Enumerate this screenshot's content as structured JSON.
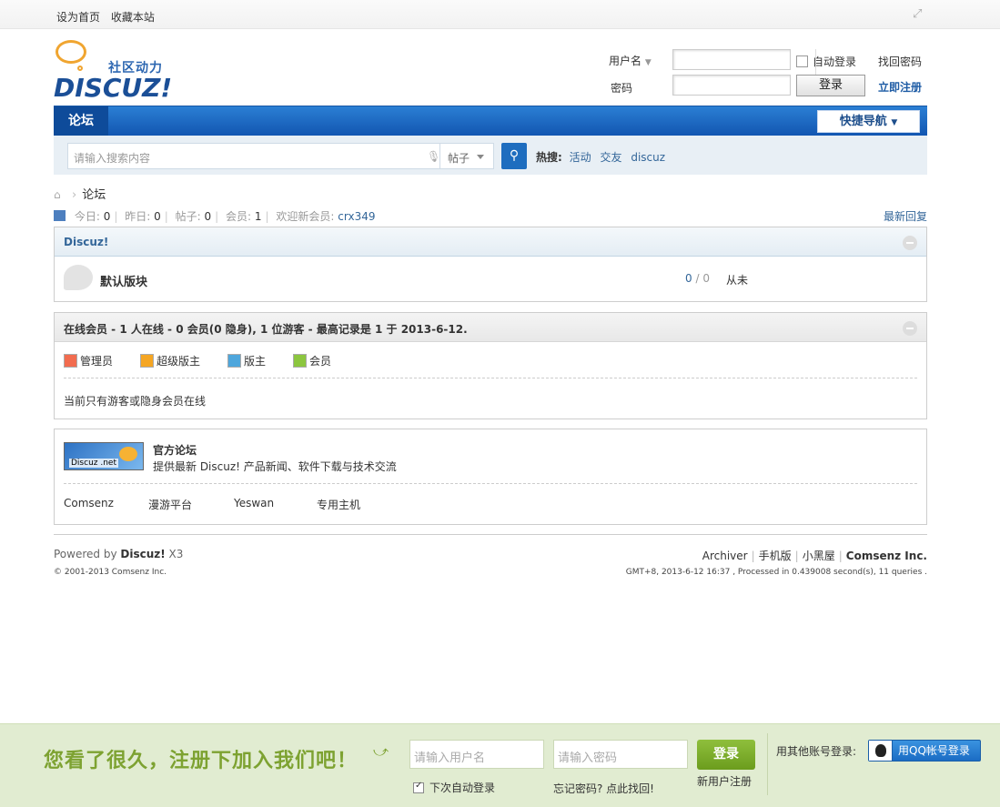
{
  "topbar": {
    "set_home": "设为首页",
    "bookmark": "收藏本站"
  },
  "logo": {
    "tagline": "社区动力",
    "brand": "DISCUZ!"
  },
  "login": {
    "username_label": "用户名",
    "password_label": "密码",
    "auto_login": "自动登录",
    "login_button": "登录",
    "find_password": "找回密码",
    "register": "立即注册"
  },
  "nav": {
    "tab_forum": "论坛",
    "quick_nav": "快捷导航"
  },
  "search": {
    "placeholder": "请输入搜索内容",
    "type": "帖子",
    "hot_label": "热搜:",
    "hot_terms": [
      "活动",
      "交友",
      "discuz"
    ]
  },
  "breadcrumb": {
    "current": "论坛"
  },
  "stats": {
    "today_label": "今日:",
    "today": "0",
    "yesterday_label": "昨日:",
    "yesterday": "0",
    "posts_label": "帖子:",
    "posts": "0",
    "members_label": "会员:",
    "members": "1",
    "welcome_label": "欢迎新会员:",
    "new_member": "crx349",
    "latest_replies": "最新回复"
  },
  "category": {
    "title": "Discuz!",
    "forum": {
      "name": "默认版块",
      "threads": "0",
      "separator": "/",
      "posts": "0",
      "last": "从未"
    }
  },
  "online": {
    "title": "在线会员 - 1 人在线 - 0 会员(0 隐身), 1 位游客 - 最高记录是 1 于 2013-6-12.",
    "roles": [
      "管理员",
      "超级版主",
      "版主",
      "会员"
    ],
    "role_colors": [
      "#f26c4f",
      "#f5a623",
      "#4ea6dc",
      "#8cc63f"
    ],
    "note": "当前只有游客或隐身会员在线"
  },
  "links": {
    "logo_text": "Discuz .net",
    "title": "官方论坛",
    "desc": "提供最新 Discuz! 产品新闻、软件下载与技术交流",
    "items": [
      "Comsenz",
      "漫游平台",
      "Yeswan",
      "专用主机"
    ]
  },
  "footer": {
    "powered_prefix": "Powered by ",
    "powered_brand": "Discuz!",
    "version": " X3",
    "copyright": "© 2001-2013 Comsenz Inc.",
    "links": [
      "Archiver",
      "手机版",
      "小黑屋"
    ],
    "company": "Comsenz Inc.",
    "timing": "GMT+8, 2013-6-12 16:37 , Processed in 0.439008 second(s), 11 queries ."
  },
  "bottombar": {
    "slogan": "您看了很久，注册下加入我们吧！",
    "username_placeholder": "请输入用户名",
    "password_placeholder": "请输入密码",
    "login_button": "登录",
    "auto_login": "下次自动登录",
    "forgot": "忘记密码? 点此找回!",
    "new_user": "新用户注册",
    "other_login": "用其他账号登录:",
    "qq_login": "用QQ帐号登录"
  }
}
